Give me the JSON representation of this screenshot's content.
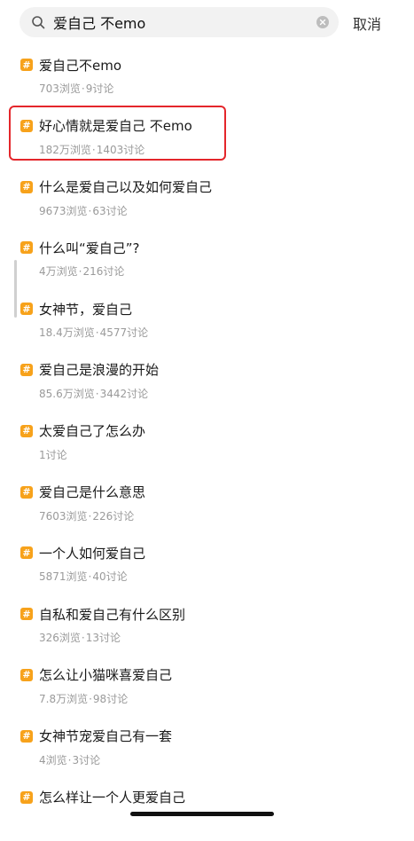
{
  "search": {
    "query": "爱自己 不emo",
    "cancel_label": "取消"
  },
  "badge_symbol": "#",
  "badge_color": "#f7a21b",
  "highlight_color": "#e4262b",
  "results": [
    {
      "title": "爱自己不emo",
      "views": "703浏览",
      "discussions": "9讨论"
    },
    {
      "title": "好心情就是爱自己 不emo",
      "views": "182万浏览",
      "discussions": "1403讨论"
    },
    {
      "title": "什么是爱自己以及如何爱自己",
      "views": "9673浏览",
      "discussions": "63讨论"
    },
    {
      "title": "什么叫“爱自己”?",
      "views": "4万浏览",
      "discussions": "216讨论"
    },
    {
      "title": "女神节，爱自己",
      "views": "18.4万浏览",
      "discussions": "4577讨论"
    },
    {
      "title": "爱自己是浪漫的开始",
      "views": "85.6万浏览",
      "discussions": "3442讨论"
    },
    {
      "title": "太爱自己了怎么办",
      "views": "",
      "discussions": "1讨论"
    },
    {
      "title": "爱自己是什么意思",
      "views": "7603浏览",
      "discussions": "226讨论"
    },
    {
      "title": "一个人如何爱自己",
      "views": "5871浏览",
      "discussions": "40讨论"
    },
    {
      "title": "自私和爱自己有什么区别",
      "views": "326浏览",
      "discussions": "13讨论"
    },
    {
      "title": "怎么让小猫咪喜爱自己",
      "views": "7.8万浏览",
      "discussions": "98讨论"
    },
    {
      "title": "女神节宠爱自己有一套",
      "views": "4浏览",
      "discussions": "3讨论"
    },
    {
      "title": "怎么样让一个人更爱自己",
      "views": "",
      "discussions": ""
    }
  ]
}
